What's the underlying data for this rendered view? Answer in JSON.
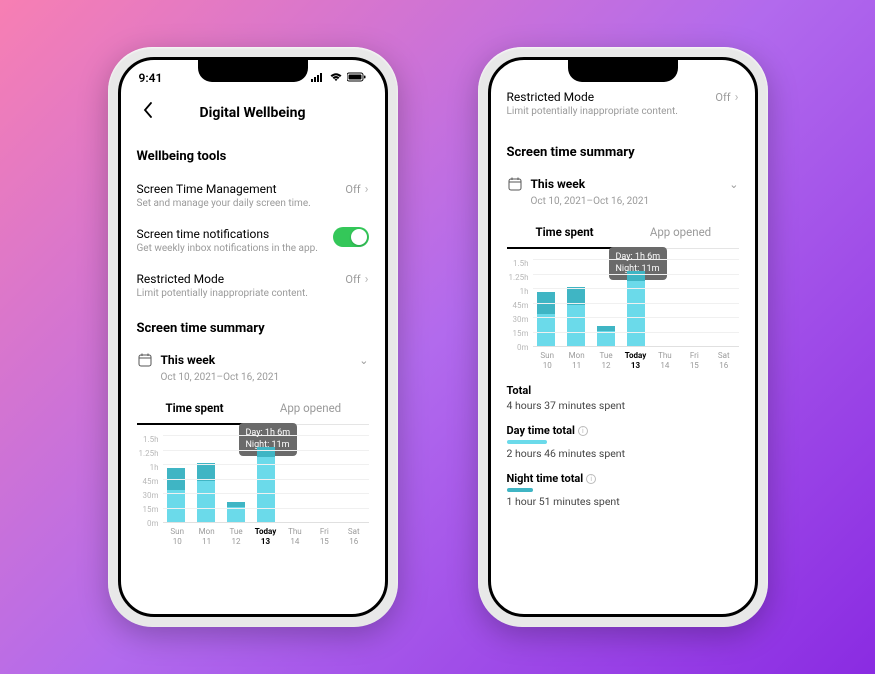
{
  "status": {
    "time": "9:41"
  },
  "header": {
    "title": "Digital Wellbeing"
  },
  "sections": {
    "tools_title": "Wellbeing tools",
    "summary_title": "Screen time summary"
  },
  "settings": {
    "screen_time_mgmt": {
      "label": "Screen Time Management",
      "desc": "Set and manage your daily screen time.",
      "value": "Off"
    },
    "notifications": {
      "label": "Screen time notifications",
      "desc": "Get weekly inbox notifications in the app."
    },
    "restricted": {
      "label": "Restricted Mode",
      "desc": "Limit potentially inappropriate content.",
      "value": "Off"
    }
  },
  "period": {
    "label": "This week",
    "range": "Oct 10, 2021–Oct 16, 2021"
  },
  "tabs": {
    "time_spent": "Time spent",
    "app_opened": "App opened"
  },
  "tooltip": {
    "day": "Day: 1h  6m",
    "night": "Night: 11m"
  },
  "chart_data": {
    "type": "bar",
    "ylabel_ticks": [
      "1.5h",
      "1.25h",
      "1h",
      "45m",
      "30m",
      "15m",
      "0m"
    ],
    "ylim_minutes": [
      0,
      90
    ],
    "x_days": [
      {
        "top": "Sun",
        "bottom": "10"
      },
      {
        "top": "Mon",
        "bottom": "11"
      },
      {
        "top": "Tue",
        "bottom": "12"
      },
      {
        "top": "Today",
        "bottom": "13"
      },
      {
        "top": "Thu",
        "bottom": "14"
      },
      {
        "top": "Fri",
        "bottom": "15"
      },
      {
        "top": "Sat",
        "bottom": "16"
      }
    ],
    "active_index": 3,
    "series": [
      {
        "name": "Day",
        "values_minutes": [
          33,
          42,
          15,
          66,
          0,
          0,
          0
        ]
      },
      {
        "name": "Night",
        "values_minutes": [
          22,
          18,
          5,
          11,
          0,
          0,
          0
        ]
      }
    ],
    "tooltip_index": 3
  },
  "totals": {
    "overall": {
      "label": "Total",
      "value": "4 hours 37 minutes spent"
    },
    "day": {
      "label": "Day time total",
      "value": "2 hours 46 minutes spent",
      "color": "#6bdaea"
    },
    "night": {
      "label": "Night time total",
      "value": "1 hour 51 minutes spent",
      "color": "#3fb5c4"
    }
  }
}
